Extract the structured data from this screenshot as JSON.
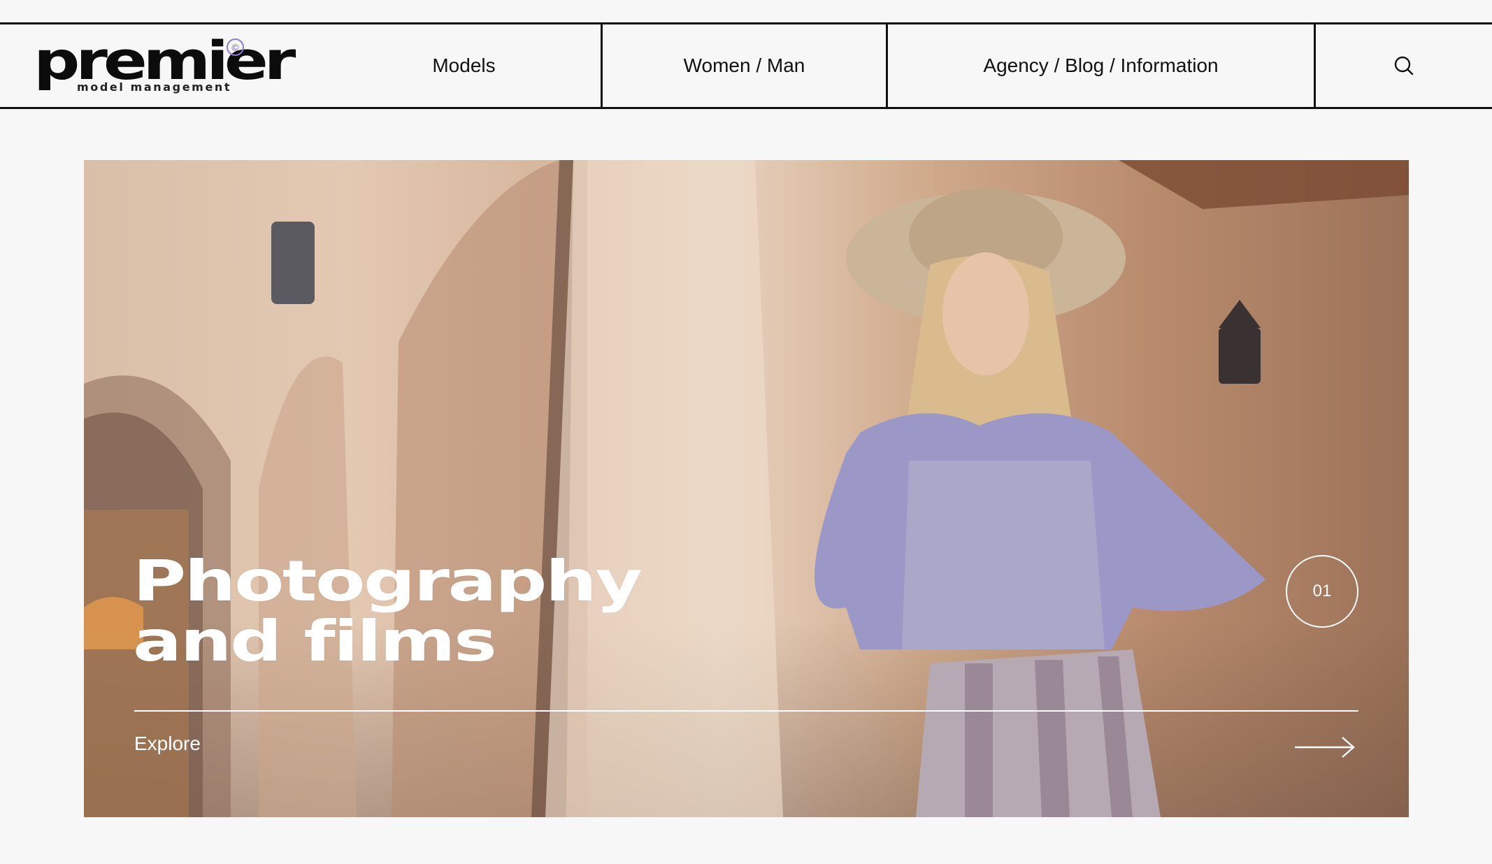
{
  "header": {
    "logo": {
      "word": "premier",
      "sub": "model management",
      "mark": "©"
    },
    "nav": [
      {
        "label": "Models"
      },
      {
        "label": "Women / Man"
      },
      {
        "label": "Agency / Blog / Information"
      }
    ],
    "search_icon": "search-icon"
  },
  "hero": {
    "title_line1": "Photography",
    "title_line2": "and films",
    "counter": "01",
    "explore_label": "Explore",
    "arrow_icon": "arrow-right-icon"
  },
  "colors": {
    "background": "#f7f7f7",
    "text": "#111111",
    "accent": "#8e7bd0",
    "overlay_text": "#ffffff"
  }
}
